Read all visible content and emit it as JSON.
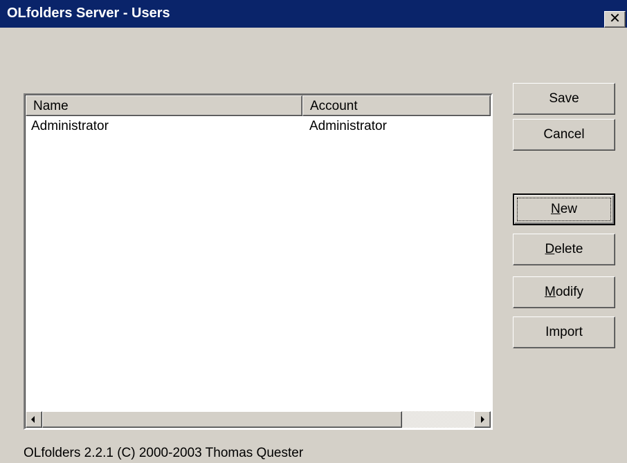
{
  "window": {
    "title": "OLfolders Server - Users",
    "close_glyph": "✕"
  },
  "users_table": {
    "columns": [
      "Name",
      "Account"
    ],
    "rows": [
      {
        "name": "Administrator",
        "account": "Administrator"
      }
    ]
  },
  "buttons": {
    "save": "Save",
    "cancel": "Cancel",
    "new": {
      "mnemonic": "N",
      "rest": "ew"
    },
    "delete": {
      "mnemonic": "D",
      "rest": "elete"
    },
    "modify": {
      "mnemonic": "M",
      "rest": "odify"
    },
    "import": "Import"
  },
  "footer": {
    "text": "OLfolders 2.2.1 (C) 2000-2003 Thomas Quester"
  },
  "colors": {
    "titlebar": "#0a246a",
    "face": "#d4d0c8",
    "list_background": "#ffffff"
  },
  "icons": {
    "close": "close-icon",
    "scroll_left": "arrow-left-icon",
    "scroll_right": "arrow-right-icon"
  }
}
